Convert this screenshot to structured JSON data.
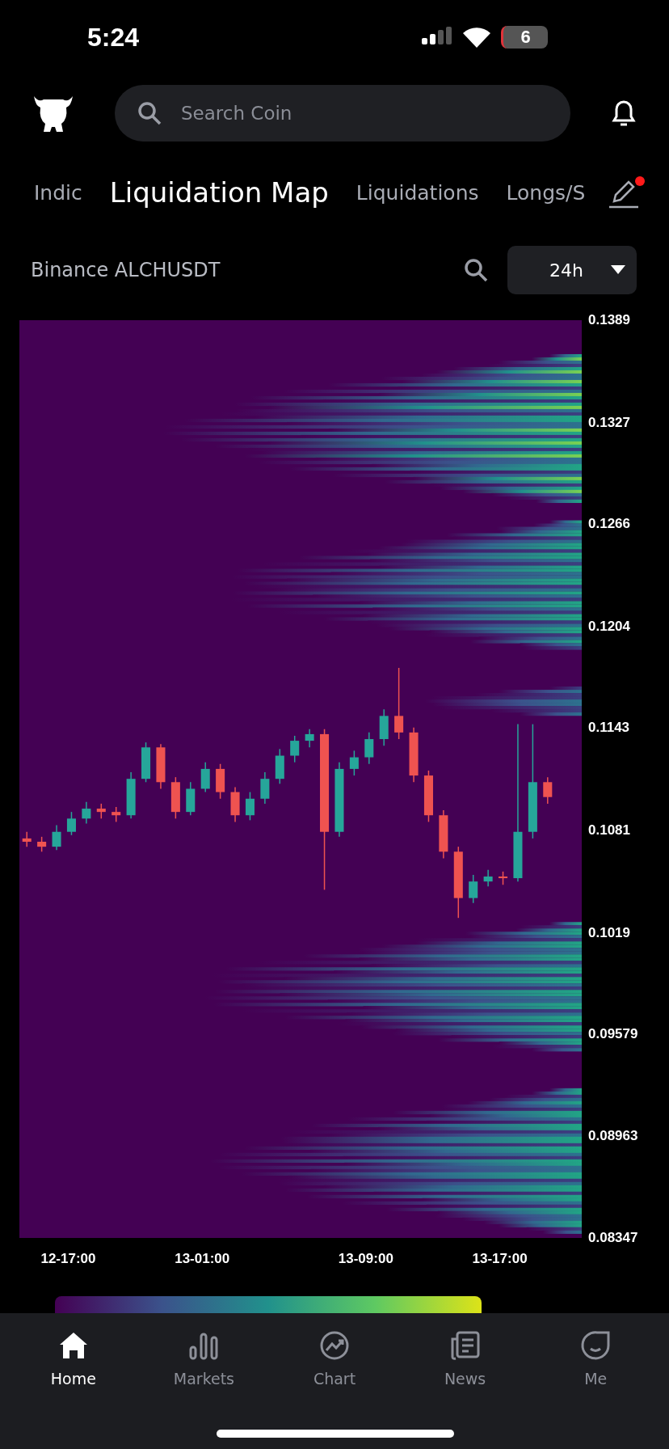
{
  "status_bar": {
    "time": "5:24",
    "battery": "6"
  },
  "search": {
    "placeholder": "Search Coin"
  },
  "tabs": [
    {
      "label": "Indic",
      "selected": false
    },
    {
      "label": "Liquidation Map",
      "selected": true
    },
    {
      "label": "Liquidations",
      "selected": false
    },
    {
      "label": "Longs/S",
      "selected": false
    }
  ],
  "edit_badge": true,
  "pair": "Binance ALCHUSDT",
  "period": "24h",
  "chart": {
    "chart_data": {
      "type": "candlestick",
      "categories": [
        null,
        null,
        null,
        "12-17:00",
        null,
        null,
        null,
        null,
        null,
        null,
        null,
        null,
        "13-01:00",
        null,
        null,
        null,
        null,
        null,
        null,
        null,
        null,
        null,
        null,
        "13-09:00",
        null,
        null,
        null,
        null,
        null,
        null,
        null,
        null,
        "13-17:00",
        null,
        null,
        null
      ],
      "ohlc": [
        [
          0.1076,
          0.108,
          0.1071,
          0.1074
        ],
        [
          0.1074,
          0.1077,
          0.1068,
          0.1071
        ],
        [
          0.1071,
          0.1084,
          0.1069,
          0.108
        ],
        [
          0.108,
          0.1092,
          0.1078,
          0.1088
        ],
        [
          0.1088,
          0.1098,
          0.1085,
          0.1094
        ],
        [
          0.1094,
          0.1097,
          0.1088,
          0.1092
        ],
        [
          0.1092,
          0.1095,
          0.1086,
          0.109
        ],
        [
          0.109,
          0.1116,
          0.1088,
          0.1112
        ],
        [
          0.1112,
          0.1134,
          0.111,
          0.1131
        ],
        [
          0.1131,
          0.1133,
          0.1106,
          0.111
        ],
        [
          0.111,
          0.1113,
          0.1088,
          0.1092
        ],
        [
          0.1092,
          0.111,
          0.109,
          0.1106
        ],
        [
          0.1106,
          0.1122,
          0.1104,
          0.1118
        ],
        [
          0.1118,
          0.1121,
          0.11,
          0.1104
        ],
        [
          0.1104,
          0.1107,
          0.1086,
          0.109
        ],
        [
          0.109,
          0.1104,
          0.1087,
          0.11
        ],
        [
          0.11,
          0.1116,
          0.1097,
          0.1112
        ],
        [
          0.1112,
          0.113,
          0.1109,
          0.1126
        ],
        [
          0.1126,
          0.1138,
          0.1122,
          0.1135
        ],
        [
          0.1135,
          0.1142,
          0.1131,
          0.1139
        ],
        [
          0.1139,
          0.1142,
          0.1045,
          0.108
        ],
        [
          0.108,
          0.1122,
          0.1077,
          0.1118
        ],
        [
          0.1118,
          0.1129,
          0.1114,
          0.1125
        ],
        [
          0.1125,
          0.114,
          0.1121,
          0.1136
        ],
        [
          0.1136,
          0.1154,
          0.1132,
          0.115
        ],
        [
          0.115,
          0.1179,
          0.1136,
          0.114
        ],
        [
          0.114,
          0.1143,
          0.111,
          0.1114
        ],
        [
          0.1114,
          0.1117,
          0.1086,
          0.109
        ],
        [
          0.109,
          0.1093,
          0.1064,
          0.1068
        ],
        [
          0.1068,
          0.1071,
          0.1028,
          0.104
        ],
        [
          0.104,
          0.1054,
          0.1037,
          0.105
        ],
        [
          0.105,
          0.1057,
          0.1047,
          0.1053
        ],
        [
          0.1053,
          0.1056,
          0.1048,
          0.1052
        ],
        [
          0.1052,
          0.1145,
          0.105,
          0.108
        ],
        [
          0.108,
          0.1145,
          0.1076,
          0.111
        ],
        [
          0.111,
          0.1113,
          0.1097,
          0.1101
        ]
      ],
      "ylim": [
        0.08347,
        0.1389
      ],
      "yticks": [
        {
          "value": 0.1389,
          "label": "0.1389"
        },
        {
          "value": 0.1327,
          "label": "0.1327"
        },
        {
          "value": 0.1266,
          "label": "0.1266"
        },
        {
          "value": 0.1204,
          "label": "0.1204"
        },
        {
          "value": 0.1143,
          "label": "0.1143"
        },
        {
          "value": 0.1081,
          "label": "0.1081"
        },
        {
          "value": 0.1019,
          "label": "0.1019"
        },
        {
          "value": 0.09579,
          "label": "0.09579"
        },
        {
          "value": 0.08963,
          "label": "0.08963"
        },
        {
          "value": 0.08347,
          "label": "0.08347"
        }
      ]
    }
  },
  "nav": [
    {
      "label": "Home",
      "kind": "home",
      "selected": true
    },
    {
      "label": "Markets",
      "kind": "bars",
      "selected": false
    },
    {
      "label": "Chart",
      "kind": "chart",
      "selected": false
    },
    {
      "label": "News",
      "kind": "news",
      "selected": false
    },
    {
      "label": "Me",
      "kind": "me",
      "selected": false
    }
  ]
}
